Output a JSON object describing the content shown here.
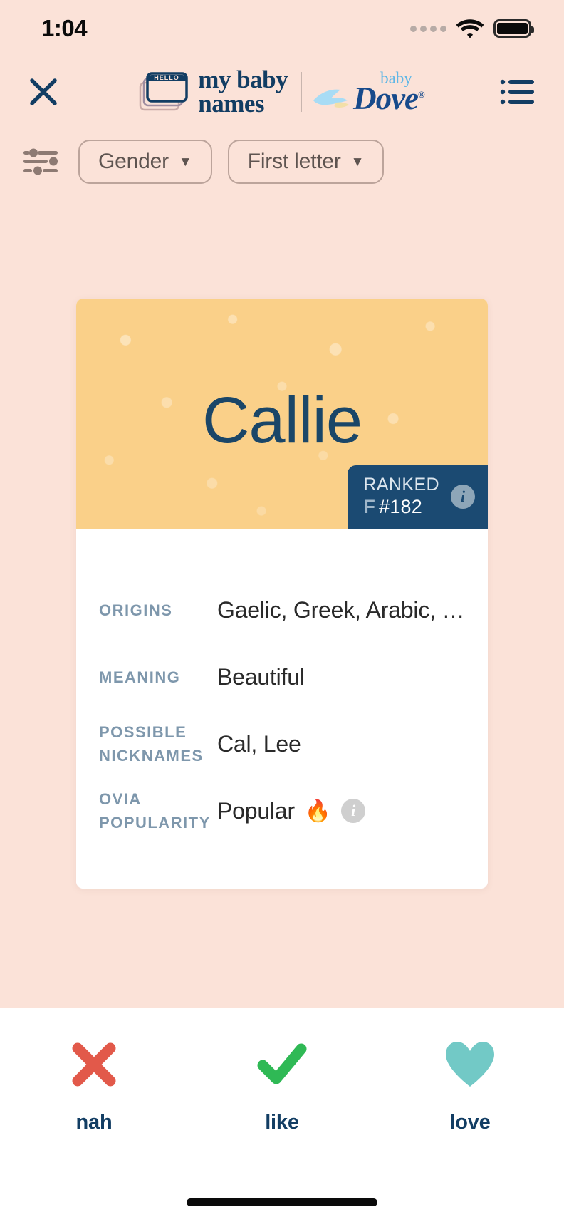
{
  "status_bar": {
    "time": "1:04",
    "signal_icon": "signal-dots-icon",
    "wifi_icon": "wifi-icon",
    "battery_icon": "battery-full-icon"
  },
  "header": {
    "close_icon": "close-icon",
    "menu_icon": "hamburger-menu-icon",
    "logo": {
      "tag_icon": "hello-name-tag-icon",
      "tag_word": "HELLO",
      "line1": "my baby",
      "line2": "names",
      "partner_bird_icon": "dove-bird-icon",
      "partner_small": "baby",
      "partner_name": "Dove",
      "partner_mark": "®"
    }
  },
  "filters": {
    "sliders_icon": "filter-sliders-icon",
    "chips": [
      {
        "label": "Gender",
        "caret": "▼"
      },
      {
        "label": "First letter",
        "caret": "▼"
      }
    ]
  },
  "card": {
    "name": "Callie",
    "rank_badge": {
      "title": "RANKED",
      "gender": "F",
      "rank": "#182",
      "info_icon": "info-icon"
    },
    "details": [
      {
        "label": "ORIGINS",
        "value": "Gaelic, Greek, Arabic, He…"
      },
      {
        "label": "MEANING",
        "value": "Beautiful"
      },
      {
        "label": "POSSIBLE NICKNAMES",
        "value": "Cal, Lee"
      },
      {
        "label": "OVIA POPULARITY",
        "value": "Popular",
        "emoji": "🔥",
        "info_icon": "info-icon"
      }
    ]
  },
  "actions": [
    {
      "label": "nah",
      "icon": "x-mark-icon",
      "color": "#E2594A"
    },
    {
      "label": "like",
      "icon": "check-mark-icon",
      "color": "#2FB955"
    },
    {
      "label": "love",
      "icon": "heart-icon",
      "color": "#72C9C6"
    }
  ],
  "colors": {
    "background": "#FBE2D8",
    "navy": "#123D63",
    "card_hero": "#FAD089",
    "badge": "#1B4A72",
    "label_blue": "#7E97AC"
  },
  "home_indicator": "home-indicator"
}
